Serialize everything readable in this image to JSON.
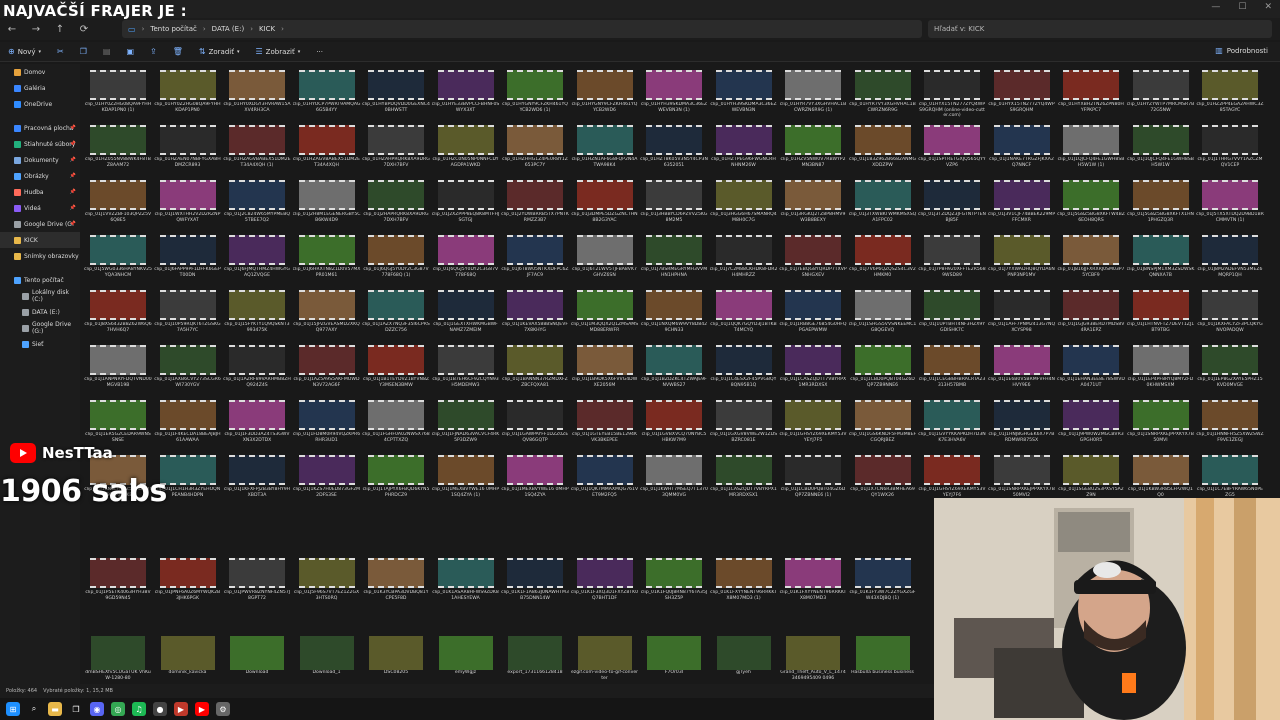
{
  "overlay": {
    "title": "NAJVAČŠÍ FRAJER JE :",
    "channel": "NesTTaa",
    "subs": "1906 sabs"
  },
  "nav": {
    "breadcrumb": [
      "Tento počítač",
      "DATA (E:)",
      "KICK"
    ],
    "search_placeholder": "Hľadať v: KICK"
  },
  "toolbar": {
    "new_label": "Nový",
    "sort_label": "Zoradiť",
    "view_label": "Zobraziť",
    "details_label": "Podrobnosti"
  },
  "sidebar": {
    "items": [
      {
        "label": "Domov",
        "icon": "home-icon",
        "color": "#e6a23c"
      },
      {
        "label": "Galéria",
        "icon": "gallery-icon",
        "color": "#3a86ff"
      },
      {
        "label": "OneDrive",
        "icon": "cloud-icon",
        "color": "#2f8cff"
      },
      {
        "label": "Pracovná plocha",
        "icon": "desktop-icon",
        "color": "#3a86ff"
      },
      {
        "label": "Stiahnuté súbory",
        "icon": "download-icon",
        "color": "#22b07d"
      },
      {
        "label": "Dokumenty",
        "icon": "document-icon",
        "color": "#7aa7e0"
      },
      {
        "label": "Obrázky",
        "icon": "picture-icon",
        "color": "#4ea3ff"
      },
      {
        "label": "Hudba",
        "icon": "music-icon",
        "color": "#ff6b5a"
      },
      {
        "label": "Videá",
        "icon": "video-icon",
        "color": "#8b5cf6"
      },
      {
        "label": "Google Drive (G:",
        "icon": "drive-icon",
        "color": "#9aa0a6"
      },
      {
        "label": "KICK",
        "icon": "folder-icon",
        "color": "#e8b84a"
      },
      {
        "label": "Snímky obrazovky",
        "icon": "folder-icon",
        "color": "#e8b84a"
      },
      {
        "label": "Tento počítač",
        "icon": "computer-icon",
        "color": "#4ea3ff"
      },
      {
        "label": "Lokálny disk (C:)",
        "icon": "disk-icon",
        "color": "#9aa0a6"
      },
      {
        "label": "DATA (E:)",
        "icon": "disk-icon",
        "color": "#9aa0a6"
      },
      {
        "label": "Google Drive (G:)",
        "icon": "drive-icon",
        "color": "#9aa0a6"
      },
      {
        "label": "Sieť",
        "icon": "network-icon",
        "color": "#4ea3ff"
      }
    ]
  },
  "files": {
    "clips": [
      "clip_01HY0Z2HG08QA9FYHHKDAP1PN0 (1)",
      "clip_01HY0Z2HG08QA9FYHHKDAP1PN0",
      "clip_01HY0XDGY3HVRAW15AXV4RH3CA",
      "clip_01HYOCP7PWRT9AMQAG6G5B4YY",
      "clip_01HYBPDQVDD0GEXNC40BHWSTT",
      "clip_01HYE33BVPCCFBHNF0SWYX3XT",
      "clip_01HYGNY9CFZKH461YQYCB2WD6 (1)",
      "clip_01HYGNY9CFZKH461YQYCB2WD6",
      "clip_01HYH39SKDMA3C36EZWEVBN3N (1)",
      "clip_01HYH39SKDMA3C36EZWEVBN3N",
      "clip_01HYR7VY3XGHVHAC1BCWRZN6R9G (1)",
      "clip_01HYR7VY3XGHVHAC1BCWRZN6R9G",
      "clip_01HYX15TN277ZYQ4WPS9GRQHM (online-video-cutter.com)",
      "clip_01HYX15TN277ZYQ4WPS9GRQHM",
      "clip_01HYXBH2TN26ZPN80HYFPKPC7",
      "clip_01HYZYWTP7MRCMSR7B72G5NW",
      "clip_01HZ2PP4EGA2AHWC3Z85TAGYC",
      "clip_01HZ055NV88WK4F8TBZ8AAM72",
      "clip_01HZAEN07NBFYGXA8HDMZCR893",
      "clip_01HZAGVBABEX51DM2ET34A4XQH (1)",
      "clip_01HZAGVBABEX51DM2ET34A4XQH",
      "clip_01HZAHPRQRK8XA9DRG7DXH7BFV",
      "clip_01HZC0N05NP0NNFCDYAGDPA1WKD",
      "clip_01HZHHG1Z4PE0R8Y1Z653PC7Y",
      "clip_01HZN1AF6G8FQP2N4ATWA98K4",
      "clip_01HZT8K05V3N5Y4CP3N6352051",
      "clip_01HZTPEG96FWGNCRHNHNM26W",
      "clip_01HZV5NW0V7RBWYP2MN3BN87",
      "clip_01J183Z962B6682ANMGXDDZPW",
      "clip_01J1SPTRETGXJQ565QYYVZP6",
      "clip_01J1NAKE7TRGZFJKXA2Q7NNCF",
      "clip_01J1QJCFQ4FE1GWH8SBH5W1W (1)",
      "clip_01J1QJCFQ4FE1GWH8SBH5W1W",
      "clip_01J1THRG7VVY1AZCZMQV1CEP",
      "clip_01J1VVZZBF103QPZZ5V6Q8E5",
      "clip_01J1WXTHH2V2D2RZNPQWFYXAT",
      "clip_01J2C824W65MYPMEBQ5TBEE7Q2",
      "clip_01J2H8M1EGENERGBY5CB6KW4D9",
      "clip_01J2HAPRQRK8XA9DRG7DXH7BFV",
      "clip_01J2XZPPP8EQ8K8MTFHJSGTGJ",
      "clip_01J2YDWBRRB5TX7PNTKRMZZ3B7",
      "clip_01J3DMPE5DZGZNCTHN8B2G3YAC",
      "clip_01J3HBBYCD6PZVVZ5KG8M2M5",
      "clip_01J3HGG6H67SMANRQ4M8H0C7G",
      "clip_01J3RGKQ2TZ8P8HMV9W3B8BEXY",
      "clip_01J3TXWBKTWMKMSXSQA1FPC02",
      "clip_01J3TZDQZ3JFGTNTPTENBJ85F",
      "clip_01J3V1CJF74BBEK229MPFFCMXR",
      "clip_01J5G8Z5BG8XKFTW4BZ6EOH8QRS",
      "clip_01J5G8Z5BG8XKFTX1HN1PHGZQ3R",
      "clip_01J5TX5XTDQ2D9BD1BRCMMVTN (1)",
      "clip_01J5WG0336HA8YNKV25YQA3NHCM",
      "clip_01J6FAPP9PF1DFFK6GEPT00DN",
      "clip_01J6FJMQTHMZ4HWGYGAQ1ZVQGE",
      "clip_01J6HRXTN8Z1D0V57MXPR01M61",
      "clip_01J6QGJ5Y0DY2C3G87V778F68Q (1)",
      "clip_01J6QGJ5Y0DY2C3G87V778F68Q",
      "clip_01J6T8W05NTKXDFPC6ZJF7AC9",
      "clip_01J6T21WV5TJFBA8VK7GHVZ6SN",
      "clip_01J7BSRMEGRYMH3VVMHN1HPHNA",
      "clip_01J7C2M88CKHDK8FDR2H4MHRZZ",
      "clip_01J7EBQG8YQRDP7TXVPSNHGXEV",
      "clip_01J7V6P6QZQSZS4C3V2HMKM0",
      "clip_01J7P8H920XFFTE2R5689WSD89",
      "clip_01J7YXWADHQ8QYDA6NPNP3NP1MV",
      "clip_01J816JJFXRXRJ0SM03P75YCBF9",
      "clip_01J8NSPJM1XM3ZSDWSKQNNXA7B",
      "clip_01J8M2ADEFVN53MEZ6MQRP1QH",
      "clip_01J8XS6432B8Z62W6Q67HVH6Q7",
      "clip_01J10P59RQKT6TZGSKG7A5H7YC",
      "clip_01J15FYKTY1Q9QSKNT3993475K",
      "clip_01J15JPZGVEASMD2XKQQ977AXY",
      "clip_01J1AZX7NQ3F35I6CPRSDZZC756",
      "clip_01J1GEXTXHWKMGBWFNAMZ7ZMEIM",
      "clip_01J1KEVAX588BSNQEVF7X8KHYG",
      "clip_01J1M3QQX2Q1ZMSAMSMD88ERWFR",
      "clip_01J1NXQM6W9VY8D8429CHN33",
      "clip_01J1QQK7GQYD3J1BTKBT4MCYQ",
      "clip_01J1RB8GE76854G0HFQPGAEPWMW",
      "clip_01J1SHGS5VVSNKEEMC1G8QGEVQ",
      "clip_01J1UPTBHT4NF3HZX9YGDISHK7C",
      "clip_01J1AFF7PNM2413G7NQXCYSP98",
      "clip_01J1GJG938ERD7MDS8V4RA1EPZ",
      "clip_01J1HTNVFTZ7DEVT1ZJ1BT9TBG",
      "clip_01J1KXFACYZF3PCQKYGNVOPADQW",
      "clip_01J1ANPNRYFDQTVND00MGVB19B",
      "clip_01J1AXB6CVY273SCGR6WI730YGV",
      "clip_01J1AZRF89VARHMB8ZHQ924Z4S",
      "clip_01J1AZ5A9S5AKFMOWDN3V72AG6F",
      "clip_01J1B1TEYDVZ1BYVN8ZY3MSEN3BMW",
      "clip_01J1B7EH6CF92CQYN93H5MDEMW3",
      "clip_01J1BANNN37RZMDXFZZBCFQXA81",
      "clip_01J1B9DK5X6FVVG4DWXE2056M",
      "clip_01J1BZDZKC4TZWAJE9FNVWBS27",
      "clip_01J1C4ESX2F45PVGBQY8QN95B1Q",
      "clip_01J1CASZQDTT7VBYRPX1MR3RDXSX",
      "clip_01J1CBD0PQBT04GZ6DQP7ZB9NNE6",
      "clip_01J1CEGBBHBRACRTA23313H57BMB",
      "clip_01J1E6B0V5BRMFVFH4NHVY9E6",
      "clip_01J1EHAN3EE8E78SWVDA0471UT",
      "clip_01J1EP4PF8RYQ8MYZFD0KHWMSXM",
      "clip_01J1EP8G2XAYE5PHZ15KVD0MVGE",
      "clip_01J1ER5G2CEDAR9WNSSNSE",
      "clip_01J1F4KECDA18BEAJBJH61AAWAA",
      "clip_01J1F3DD3AZ4TS3GWVXN3X2DTDX",
      "clip_01J1FD8M0R94VQZKPR6RHR3UD1",
      "clip_01J1FGHF0A02NWSX7684CPTTXZQ",
      "clip_01J1FJNAD63VACVCF4RK5P3DZW9",
      "clip_01J1GAWPAYFF1DZZ0ZEQV86GQTP",
      "clip_01J1GTEYEB15BE1294KVK3BKEPEE",
      "clip_01J1GVBXVCQ70NYBC5HBKW7M9",
      "clip_01J1GXGV8VWE2W1ZDSBZRC081E",
      "clip_01J1GHSYZ69XEKMY53VYEYJ7F5",
      "clip_01J1GS6KNDF5FM3M8EFCGQRJBEZ",
      "clip_01J1GVYYKKAPKDH7D3NK7E3HVA6V",
      "clip_01J1HNJ8GHGEK6X7P7BRDMWR875SX",
      "clip_01J1J9PW0W2MGCBVR3GPGH0R5",
      "clip_01J1SNRPXKEJPPXKYX7B50MVI",
      "clip_01J1HNNFH5Z5XWZSWZF9VE1ZEGJ",
      "clip_01J1KN6LHS5Z5NHDAQTY5G3AJBZKB",
      "clip_01J1CH1H3R3ZYEHOQNPEANB4HDPN",
      "clip_01J1KFXFPJ2B3BY8HY9HXBDT3A",
      "clip_01J1KZS7H0ED873GF2M2DFS3SE",
      "clip_01J1TAJPYX6FBQD6KYN5PHRDCZ9",
      "clip_01J1MEXBVYWE16 0MHP1SQ4ZYA (1)",
      "clip_01J1MEXBVYWE16 0MHP1SQ4ZYA",
      "clip_01J1QK7MMAXMQG761VET9M2FQ5",
      "clip_01J1KWHT7MSEQ7T13703QMM0VG",
      "clip_01J1CASZQDT7VBYRPX1MR3RDXSX1",
      "clip_01J1CBD0PQBT04GZ6DQP7ZBNNE6 (1)",
      "clip_01J1X7CN6R3BMHEA69QY1WX26",
      "clip_01J1GHSYZ69XEKMY53VYEYJ7F6",
      "clip_01J1SNRPXKEJPPXKYX7B50MVI2",
      "clip_01J1SGE8U2S3PXSY5A2Z9N",
      "clip_01J1KBW3R85LFP2WQ1Q0",
      "clip_01J1C7E8FYRAW65N0PEZG5",
      "clip_01J1P5ETK4063HYH38V9GD59N45",
      "clip_01JPNF6A0Z6MYWQK2B3JHK6PGK",
      "clip_01JPWVR8ZNYNF4ZN57J8GPT72",
      "clip_01J5F96S7VT7EZ1Z2GX3HTS0RQ",
      "clip_01K3YCBPA3DVDBQ81YCPE5F8D",
      "clip_01K1ASAR8HFWS9ZDK81AHESYEWA",
      "clip_01K1F1A863J0NAWHTM3B75DNN14W",
      "clip_01K1F3XQ3D1FXYZ8TK0Q7BHT1DF",
      "clip_01K1FQ0J8RN87Y6TA35JSH3Z5P",
      "clip_01K1FXYYNENT96RRKKTX8M07MD3 (1)",
      "clip_01K1FXYYNENT96RRKKTX8M07MD3",
      "clip_01K1FY3W7C2ZYGXZGFW43XDJBQ (1)"
    ],
    "named": [
      "dmBSHEXfv5CUGaTUK VhKuW-1280-80",
      "dominik_kavicka",
      "Download",
      "Download_1",
      "DSC08205",
      "emyWgjz",
      "export_1731166128418",
      "ezgif.com-video-to-gif-converter",
      "F7Or03I",
      "gjTyeh",
      "Grand_Theft_Auto_V_L_14743469495409 0496",
      "Hasbulla business business"
    ]
  },
  "status": {
    "items_count": "Položky: 464",
    "selected": "Vybraté položky: 1, 15,2 MB"
  },
  "taskbar": {
    "icons": [
      "windows-start-icon",
      "search-icon",
      "file-explorer-icon",
      "taskview-icon",
      "discord-icon",
      "chrome-icon",
      "spotify-icon",
      "obs-icon",
      "media-icon",
      "youtube-icon",
      "settings-icon"
    ]
  },
  "colors": {
    "accent": "#4ea3ff",
    "window_bg": "#191919",
    "youtube_red": "#ff0000"
  }
}
